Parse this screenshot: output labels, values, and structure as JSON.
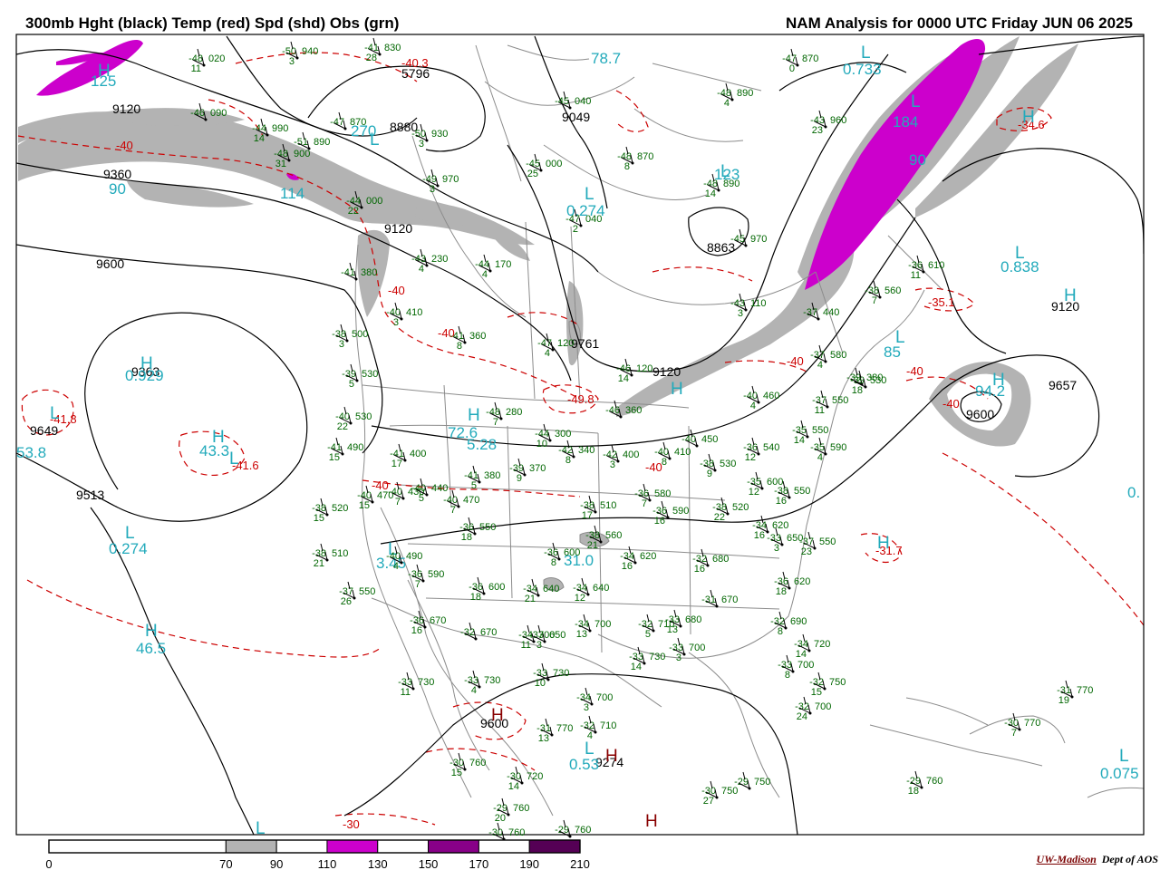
{
  "header": {
    "left": "300mb Hght (black) Temp (red) Spd (shd) Obs (grn)",
    "right": "NAM Analysis for 0000 UTC Friday  JUN 06 2025"
  },
  "credit": {
    "org": "UW-Madison",
    "dept": "Dept of AOS"
  },
  "colors": {
    "height_contour": "#000000",
    "temp_contour": "#cc0000",
    "obs": "#006600",
    "max_label": "#22aabb",
    "border": "#888888",
    "speed_70_90": "#b3b3b3",
    "speed_110_130": "#cc00cc",
    "speed_150_170": "#880088",
    "speed_190_210": "#550055"
  },
  "colorbar": {
    "ticks": [
      "0",
      "70",
      "90",
      "110",
      "130",
      "150",
      "170",
      "190",
      "210"
    ],
    "bins": [
      {
        "from": 0,
        "to": 70,
        "color": "#ffffff"
      },
      {
        "from": 70,
        "to": 90,
        "color": "#b3b3b3"
      },
      {
        "from": 90,
        "to": 110,
        "color": "#ffffff"
      },
      {
        "from": 110,
        "to": 130,
        "color": "#cc00cc"
      },
      {
        "from": 130,
        "to": 150,
        "color": "#ffffff"
      },
      {
        "from": 150,
        "to": 170,
        "color": "#880088"
      },
      {
        "from": 170,
        "to": 190,
        "color": "#ffffff"
      },
      {
        "from": 190,
        "to": 210,
        "color": "#550055"
      }
    ]
  },
  "height_labels": [
    "9120",
    "9360",
    "9600",
    "8880",
    "5796",
    "9049",
    "8863",
    "9120",
    "9120",
    "9120",
    "9657",
    "9600",
    "9363",
    "9649",
    "9513",
    "9600",
    "9274",
    "9761"
  ],
  "temp_labels": [
    "-40",
    "-40",
    "-40",
    "-40",
    "-40",
    "-40",
    "-40",
    "-40",
    "-49.8",
    "-34.6",
    "-35.1",
    "-41.8",
    "-41.6",
    "-31.7",
    "-30",
    "-40.3"
  ],
  "centers": {
    "H": [
      "H",
      "H",
      "H",
      "H",
      "H",
      "H",
      "H",
      "H",
      "H",
      "H",
      "H",
      "H",
      "H"
    ],
    "L": [
      "L",
      "L",
      "L",
      "L",
      "L",
      "L",
      "L",
      "L",
      "L",
      "L",
      "L",
      "L",
      "L",
      "L"
    ]
  },
  "speed_extremes": [
    "125",
    "114",
    "270",
    "78.7",
    "0.733",
    "184",
    "90",
    "123",
    "0.274",
    "0.838",
    "85",
    "94.2",
    "0.929",
    "53.8",
    "43.3",
    "72.6",
    "5.28",
    "0.274",
    "46.5",
    "3.45",
    "31.0",
    "0.53",
    "0.075",
    "90",
    "0."
  ],
  "obs": [
    {
      "t": "-48",
      "h": "020",
      "s": "11"
    },
    {
      "t": "-50",
      "h": "940",
      "s": "3"
    },
    {
      "t": "-41",
      "h": "830",
      "s": "28"
    },
    {
      "t": "-46",
      "h": "090",
      "s": ""
    },
    {
      "t": "-44",
      "h": "990",
      "s": "14"
    },
    {
      "t": "-47",
      "h": "870",
      "s": ""
    },
    {
      "t": "-51",
      "h": "890",
      "s": ""
    },
    {
      "t": "-50",
      "h": "930",
      "s": "3"
    },
    {
      "t": "-48",
      "h": "900",
      "s": "31"
    },
    {
      "t": "-45",
      "h": "040",
      "s": ""
    },
    {
      "t": "-45",
      "h": "000",
      "s": "25"
    },
    {
      "t": "-48",
      "h": "870",
      "s": "8"
    },
    {
      "t": "-48",
      "h": "890",
      "s": "14"
    },
    {
      "t": "-49",
      "h": "970",
      "s": "3"
    },
    {
      "t": "-47",
      "h": "870",
      "s": "0"
    },
    {
      "t": "-48",
      "h": "890",
      "s": "4"
    },
    {
      "t": "-43",
      "h": "960",
      "s": "23"
    },
    {
      "t": "-47",
      "h": "040",
      "s": "2"
    },
    {
      "t": "-45",
      "h": "970",
      "s": ""
    },
    {
      "t": "-44",
      "h": "000",
      "s": "22"
    },
    {
      "t": "-43",
      "h": "230",
      "s": "4"
    },
    {
      "t": "-44",
      "h": "170",
      "s": "4"
    },
    {
      "t": "-41",
      "h": "380",
      "s": ""
    },
    {
      "t": "-40",
      "h": "410",
      "s": "3"
    },
    {
      "t": "-41",
      "h": "360",
      "s": "8"
    },
    {
      "t": "-38",
      "h": "500",
      "s": "3"
    },
    {
      "t": "-47",
      "h": "120",
      "s": "4"
    },
    {
      "t": "-43",
      "h": "110",
      "s": "3"
    },
    {
      "t": "-37",
      "h": "440",
      "s": ""
    },
    {
      "t": "-38",
      "h": "560",
      "s": "7"
    },
    {
      "t": "-36",
      "h": "610",
      "s": "11"
    },
    {
      "t": "-39",
      "h": "380",
      "s": ""
    },
    {
      "t": "-39",
      "h": "530",
      "s": "5"
    },
    {
      "t": "-46",
      "h": "120",
      "s": "14"
    },
    {
      "t": "-46",
      "h": "360",
      "s": ""
    },
    {
      "t": "-37",
      "h": "580",
      "s": "4"
    },
    {
      "t": "-39",
      "h": "530",
      "s": "18"
    },
    {
      "t": "-40",
      "h": "530",
      "s": "22"
    },
    {
      "t": "-48",
      "h": "280",
      "s": "7"
    },
    {
      "t": "-40",
      "h": "460",
      "s": "4"
    },
    {
      "t": "-37",
      "h": "550",
      "s": "11"
    },
    {
      "t": "-41",
      "h": "490",
      "s": "15"
    },
    {
      "t": "-41",
      "h": "400",
      "s": "17"
    },
    {
      "t": "-44",
      "h": "300",
      "s": "10"
    },
    {
      "t": "-42",
      "h": "340",
      "s": "8"
    },
    {
      "t": "-42",
      "h": "400",
      "s": "3"
    },
    {
      "t": "-40",
      "h": "410",
      "s": "8"
    },
    {
      "t": "-40",
      "h": "450",
      "s": ""
    },
    {
      "t": "-35",
      "h": "550",
      "s": "14"
    },
    {
      "t": "-36",
      "h": "540",
      "s": "12"
    },
    {
      "t": "-35",
      "h": "590",
      "s": "4"
    },
    {
      "t": "-41",
      "h": "380",
      "s": "5"
    },
    {
      "t": "-39",
      "h": "370",
      "s": "9"
    },
    {
      "t": "-38",
      "h": "530",
      "s": "9"
    },
    {
      "t": "-38",
      "h": "520",
      "s": "15"
    },
    {
      "t": "-40",
      "h": "470",
      "s": "15"
    },
    {
      "t": "-40",
      "h": "430",
      "s": "7"
    },
    {
      "t": "-40",
      "h": "440",
      "s": "5"
    },
    {
      "t": "-40",
      "h": "470",
      "s": "7"
    },
    {
      "t": "-38",
      "h": "510",
      "s": "17"
    },
    {
      "t": "-36",
      "h": "580",
      "s": "7"
    },
    {
      "t": "-35",
      "h": "600",
      "s": "12"
    },
    {
      "t": "-38",
      "h": "550",
      "s": "16"
    },
    {
      "t": "-36",
      "h": "590",
      "s": "16"
    },
    {
      "t": "-38",
      "h": "520",
      "s": "22"
    },
    {
      "t": "-38",
      "h": "510",
      "s": "21"
    },
    {
      "t": "-40",
      "h": "490",
      "s": "4"
    },
    {
      "t": "-36",
      "h": "550",
      "s": "18"
    },
    {
      "t": "-38",
      "h": "560",
      "s": "21"
    },
    {
      "t": "-36",
      "h": "600",
      "s": "8"
    },
    {
      "t": "-34",
      "h": "620",
      "s": "16"
    },
    {
      "t": "-34",
      "h": "620",
      "s": "16"
    },
    {
      "t": "-33",
      "h": "650",
      "s": "3"
    },
    {
      "t": "-37",
      "h": "550",
      "s": "23"
    },
    {
      "t": "-37",
      "h": "550",
      "s": "26"
    },
    {
      "t": "-36",
      "h": "590",
      "s": "7"
    },
    {
      "t": "-36",
      "h": "600",
      "s": "18"
    },
    {
      "t": "-34",
      "h": "640",
      "s": "21"
    },
    {
      "t": "-34",
      "h": "640",
      "s": "12"
    },
    {
      "t": "-32",
      "h": "680",
      "s": "16"
    },
    {
      "t": "-31",
      "h": "670",
      "s": ""
    },
    {
      "t": "-33",
      "h": "650",
      "s": "3"
    },
    {
      "t": "-36",
      "h": "620",
      "s": "18"
    },
    {
      "t": "-36",
      "h": "670",
      "s": "16"
    },
    {
      "t": "-32",
      "h": "670",
      "s": ""
    },
    {
      "t": "-34",
      "h": "700",
      "s": "11"
    },
    {
      "t": "-34",
      "h": "700",
      "s": "13"
    },
    {
      "t": "-32",
      "h": "710",
      "s": "5"
    },
    {
      "t": "-33",
      "h": "680",
      "s": "13"
    },
    {
      "t": "-32",
      "h": "690",
      "s": "8"
    },
    {
      "t": "-34",
      "h": "720",
      "s": "14"
    },
    {
      "t": "-33",
      "h": "730",
      "s": "11"
    },
    {
      "t": "-33",
      "h": "730",
      "s": "4"
    },
    {
      "t": "-33",
      "h": "730",
      "s": "10"
    },
    {
      "t": "-33",
      "h": "730",
      "s": "14"
    },
    {
      "t": "-33",
      "h": "700",
      "s": "3"
    },
    {
      "t": "-33",
      "h": "700",
      "s": "8"
    },
    {
      "t": "-32",
      "h": "750",
      "s": "15"
    },
    {
      "t": "-34",
      "h": "700",
      "s": "3"
    },
    {
      "t": "-32",
      "h": "700",
      "s": "24"
    },
    {
      "t": "-31",
      "h": "770",
      "s": "19"
    },
    {
      "t": "-31",
      "h": "770",
      "s": "13"
    },
    {
      "t": "-32",
      "h": "710",
      "s": "4"
    },
    {
      "t": "-30",
      "h": "770",
      "s": "7"
    },
    {
      "t": "-30",
      "h": "760",
      "s": "15"
    },
    {
      "t": "-30",
      "h": "720",
      "s": "14"
    },
    {
      "t": "-29",
      "h": "760",
      "s": "18"
    },
    {
      "t": "-29",
      "h": "760",
      "s": "20"
    },
    {
      "t": "-30",
      "h": "750",
      "s": "27"
    },
    {
      "t": "-29",
      "h": "750",
      "s": ""
    },
    {
      "t": "-30",
      "h": "760",
      "s": ""
    },
    {
      "t": "-29",
      "h": "760",
      "s": ""
    }
  ]
}
